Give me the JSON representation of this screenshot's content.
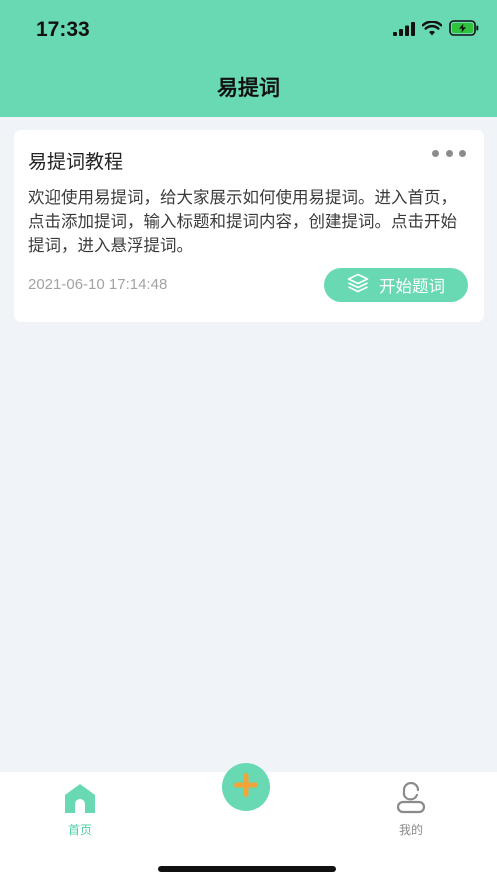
{
  "status_bar": {
    "time": "17:33"
  },
  "nav": {
    "title": "易提词"
  },
  "card": {
    "title": "易提词教程",
    "content": "欢迎使用易提词，给大家展示如何使用易提词。进入首页，点击添加提词，输入标题和提词内容，创建提词。点击开始提词，进入悬浮提词。",
    "date": "2021-06-10 17:14:48",
    "start_button_label": "开始题词"
  },
  "tabbar": {
    "home_label": "首页",
    "mine_label": "我的"
  },
  "colors": {
    "accent": "#68d9b3",
    "accent_text": "#4fcfa9",
    "add_plus": "#f2a33a",
    "battery": "#2fc23d"
  }
}
